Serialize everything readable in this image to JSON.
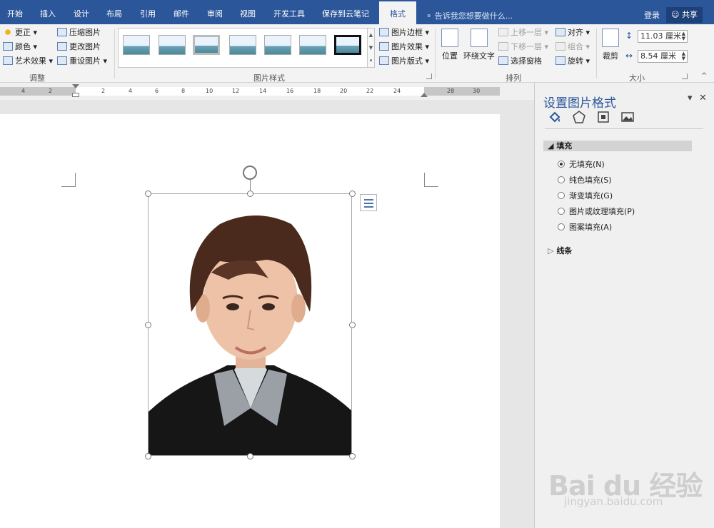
{
  "tabs": [
    "开始",
    "插入",
    "设计",
    "布局",
    "引用",
    "邮件",
    "审阅",
    "视图",
    "开发工具",
    "保存到云笔记",
    "格式"
  ],
  "active_tab": "格式",
  "tell_me": "告诉我您想要做什么...",
  "login": "登录",
  "share": "共享",
  "adjust": {
    "label": "调整",
    "corrections": "更正",
    "color": "颜色",
    "artistic": "艺术效果",
    "compress": "压缩图片",
    "change": "更改图片",
    "reset": "重设图片"
  },
  "styles": {
    "label": "图片样式",
    "border": "图片边框",
    "effects": "图片效果",
    "layout": "图片版式"
  },
  "arrange": {
    "label": "排列",
    "position": "位置",
    "wrap": "环绕文字",
    "bring_forward": "上移一层",
    "send_backward": "下移一层",
    "selection_pane": "选择窗格",
    "align": "对齐",
    "group": "组合",
    "rotate": "旋转"
  },
  "size": {
    "label": "大小",
    "crop": "裁剪",
    "height": "11.03 厘米",
    "width": "8.54 厘米"
  },
  "ruler_numbers": [
    "4",
    "2",
    "2",
    "4",
    "6",
    "8",
    "10",
    "12",
    "14",
    "16",
    "18",
    "20",
    "22",
    "24",
    "28",
    "30"
  ],
  "pane": {
    "title": "设置图片格式",
    "fill_section": "填充",
    "options": [
      "无填充(N)",
      "纯色填充(S)",
      "渐变填充(G)",
      "图片或纹理填充(P)",
      "图案填充(A)"
    ],
    "selected_option": 0,
    "line_section": "线条"
  },
  "watermark": {
    "brand": "Bai du 经验",
    "url": "jingyan.baidu.com"
  }
}
